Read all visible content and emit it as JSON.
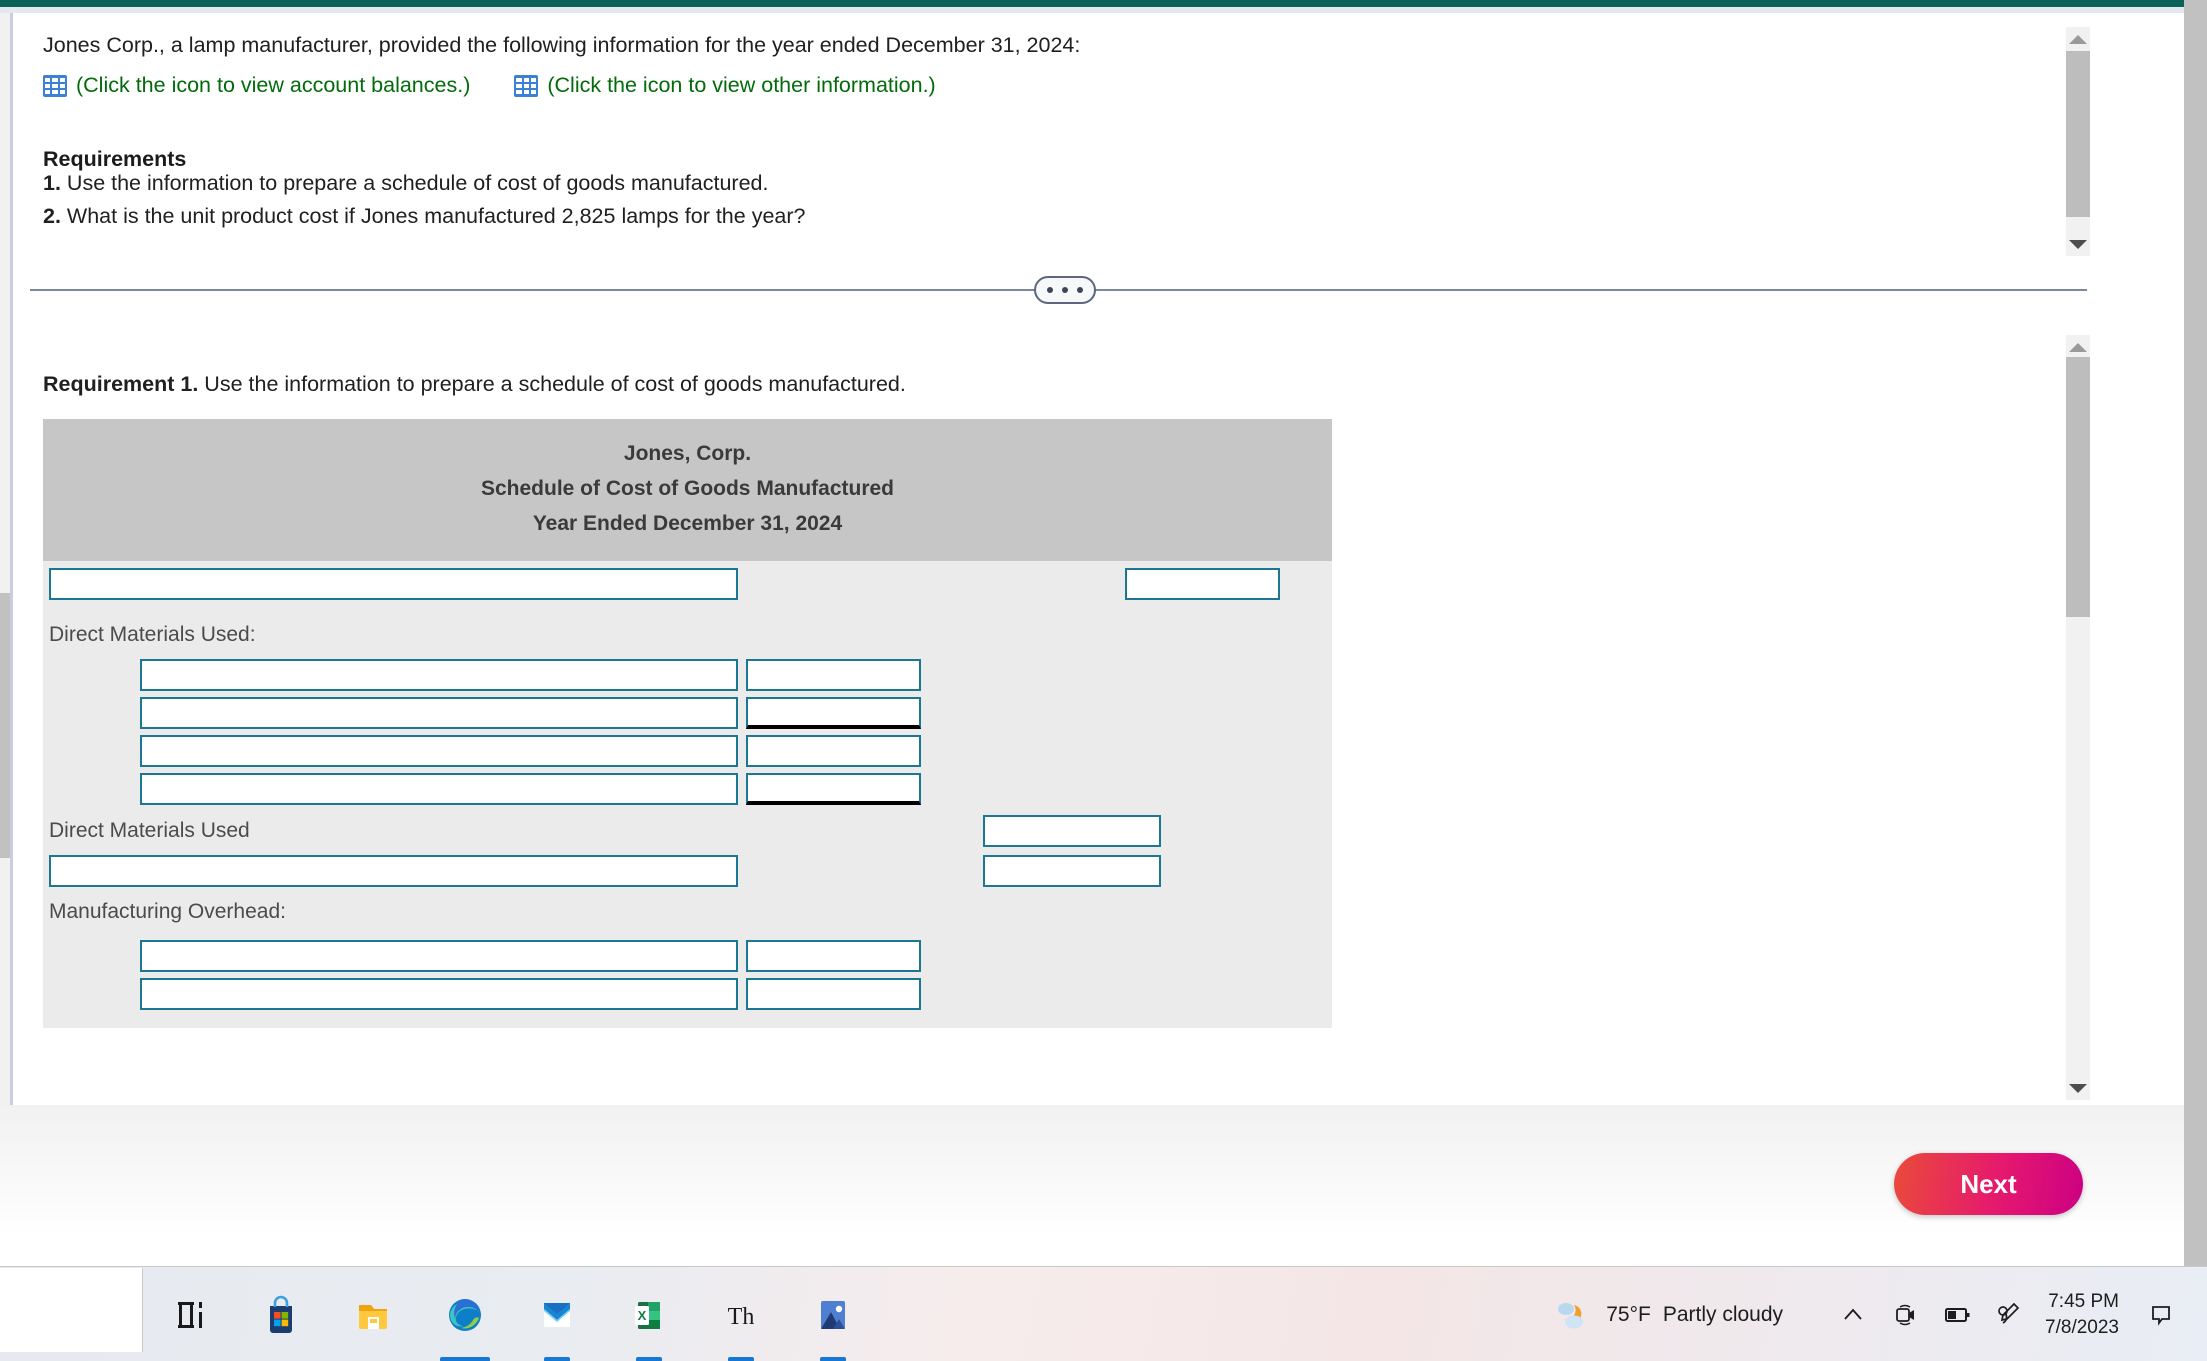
{
  "problem": {
    "intro": "Jones Corp., a lamp manufacturer, provided the following information for the year ended December 31, 2024:",
    "icon_links": [
      {
        "icon": "spreadsheet-icon",
        "label": "(Click the icon to view account balances.)"
      },
      {
        "icon": "spreadsheet-icon",
        "label": "(Click the icon to view other information.)"
      }
    ],
    "requirements_heading": "Requirements",
    "requirements": [
      {
        "num": "1.",
        "text": " Use the information to prepare a schedule of cost of goods manufactured."
      },
      {
        "num": "2.",
        "text": " What is the unit product cost if Jones manufactured 2,825 lamps for the year?"
      }
    ]
  },
  "answer": {
    "requirement_label": "Requirement 1.",
    "requirement_text": " Use the information to prepare a schedule of cost of goods manufactured.",
    "sheet": {
      "title_line_1": "Jones, Corp.",
      "title_line_2": "Schedule of Cost of Goods Manufactured",
      "title_line_3": "Year Ended December 31, 2024",
      "labels": {
        "direct_materials_used_header": "Direct Materials Used:",
        "direct_materials_used_total": "Direct Materials Used",
        "manufacturing_overhead_header": "Manufacturing Overhead:"
      },
      "inputs": {
        "row1_desc": "",
        "row1_amount": "",
        "dm_line1_desc": "",
        "dm_line1_amount": "",
        "dm_line2_desc": "",
        "dm_line2_amount": "",
        "dm_line3_desc": "",
        "dm_line3_amount": "",
        "dm_line4_desc": "",
        "dm_line4_amount": "",
        "dm_total_amount": "",
        "dl_desc": "",
        "dl_amount": "",
        "moh_line1_desc": "",
        "moh_line1_amount": "",
        "moh_line2_desc": "",
        "moh_line2_amount": ""
      }
    }
  },
  "footer": {
    "next_label": "Next"
  },
  "taskbar": {
    "search_placeholder": "",
    "apps": [
      {
        "name": "task-view-icon",
        "label": "Task View",
        "active": false
      },
      {
        "name": "microsoft-store-icon",
        "label": "Microsoft Store",
        "active": false
      },
      {
        "name": "file-explorer-icon",
        "label": "File Explorer",
        "active": false
      },
      {
        "name": "microsoft-edge-icon",
        "label": "Microsoft Edge",
        "active": true
      },
      {
        "name": "mail-icon",
        "label": "Mail",
        "active": true
      },
      {
        "name": "excel-icon",
        "label": "Excel",
        "active": true
      },
      {
        "name": "thesaurus-icon",
        "label": "Th",
        "active": true
      },
      {
        "name": "photos-icon",
        "label": "Photos",
        "active": true
      }
    ],
    "tray": {
      "weather_temp": "75°F",
      "weather_desc": "Partly cloudy",
      "icons": [
        {
          "name": "show-hidden-icons-chevron",
          "label": "Show hidden icons"
        },
        {
          "name": "camera-icon",
          "label": "Camera"
        },
        {
          "name": "battery-icon",
          "label": "Battery"
        },
        {
          "name": "pen-icon",
          "label": "Pen menu"
        }
      ],
      "time": "7:45 PM",
      "date": "7/8/2023",
      "notification": "notification-icon"
    }
  },
  "colors": {
    "top_band": "#0a6158",
    "field_border": "#1b7792",
    "link_green": "#036b0b",
    "sheet_header_bg": "#c6c6c6",
    "sheet_body_bg": "#ebebeb"
  }
}
